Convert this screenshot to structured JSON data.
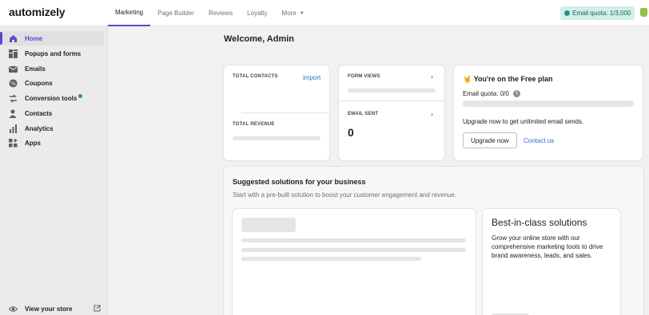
{
  "app": {
    "logo": "automizely"
  },
  "topnav": {
    "tabs": [
      "Marketing",
      "Page Builder",
      "Reviews",
      "Loyalty",
      "More"
    ],
    "quota_pill": "Email quota: 1/3,000"
  },
  "sidebar": {
    "items": [
      {
        "label": "Home",
        "icon": "home-icon"
      },
      {
        "label": "Popups and forms",
        "icon": "forms-icon"
      },
      {
        "label": "Emails",
        "icon": "envelope-icon"
      },
      {
        "label": "Coupons",
        "icon": "coupon-icon"
      },
      {
        "label": "Conversion tools",
        "icon": "conversion-icon"
      },
      {
        "label": "Contacts",
        "icon": "contacts-icon"
      },
      {
        "label": "Analytics",
        "icon": "analytics-icon"
      },
      {
        "label": "Apps",
        "icon": "apps-icon"
      }
    ],
    "view_store": "View your store"
  },
  "main": {
    "welcome": "Welcome, Admin",
    "stats": {
      "total_contacts": "TOTAL CONTACTS",
      "import": "import",
      "total_revenue": "TOTAL REVENUE",
      "form_views": "FORM VIEWS",
      "email_sent": "EMAIL SENT",
      "email_sent_value": "0"
    },
    "plan": {
      "emoji": "🤘",
      "title": "You're on the Free plan",
      "quota": "Email quota: 0/0",
      "upgrade_text": "Upgrade now to get unlimited email sends.",
      "upgrade_button": "Upgrade now",
      "contact": "Contact us"
    },
    "suggested": {
      "title": "Suggested solutions for your business",
      "subtitle": "Start with a pre-built solution to boost your customer engagement and revenue.",
      "best_title": "Best-in-class solutions",
      "best_desc": "Grow your online store with our comprehensive marketing tools to drive brand awareness, leads, and sales."
    }
  },
  "colors": {
    "accent": "#5b47d6",
    "link": "#2c6ecb",
    "teal": "#1a9c84"
  }
}
